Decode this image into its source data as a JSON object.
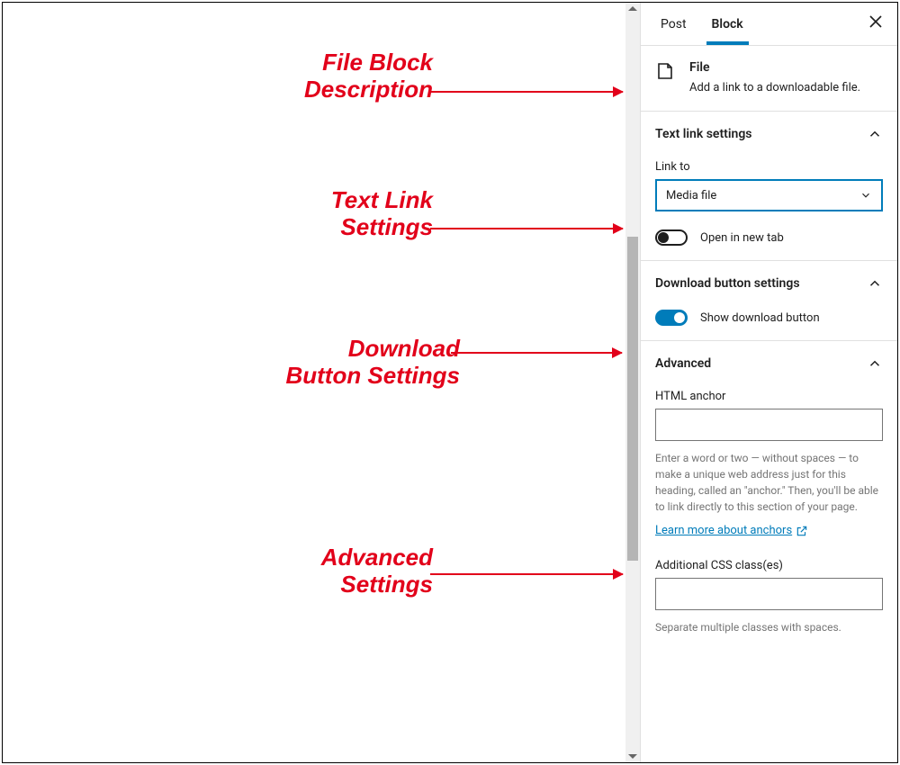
{
  "tabs": {
    "post": "Post",
    "block": "Block"
  },
  "blockInfo": {
    "title": "File",
    "subtitle": "Add a link to a downloadable file."
  },
  "sections": {
    "textLink": {
      "title": "Text link settings",
      "linkToLabel": "Link to",
      "linkToValue": "Media file",
      "openNewTabLabel": "Open in new tab"
    },
    "download": {
      "title": "Download button settings",
      "showLabel": "Show download button"
    },
    "advanced": {
      "title": "Advanced",
      "anchorLabel": "HTML anchor",
      "anchorHelp": "Enter a word or two — without spaces — to make a unique web address just for this heading, called an \"anchor.\" Then, you'll be able to link directly to this section of your page.",
      "anchorLink": "Learn more about anchors",
      "cssLabel": "Additional CSS class(es)",
      "cssHelp": "Separate multiple classes with spaces."
    }
  },
  "annotations": {
    "a1": "File Block\nDescription",
    "a2": "Text Link\nSettings",
    "a3": "Download\nButton Settings",
    "a4": "Advanced\nSettings"
  }
}
